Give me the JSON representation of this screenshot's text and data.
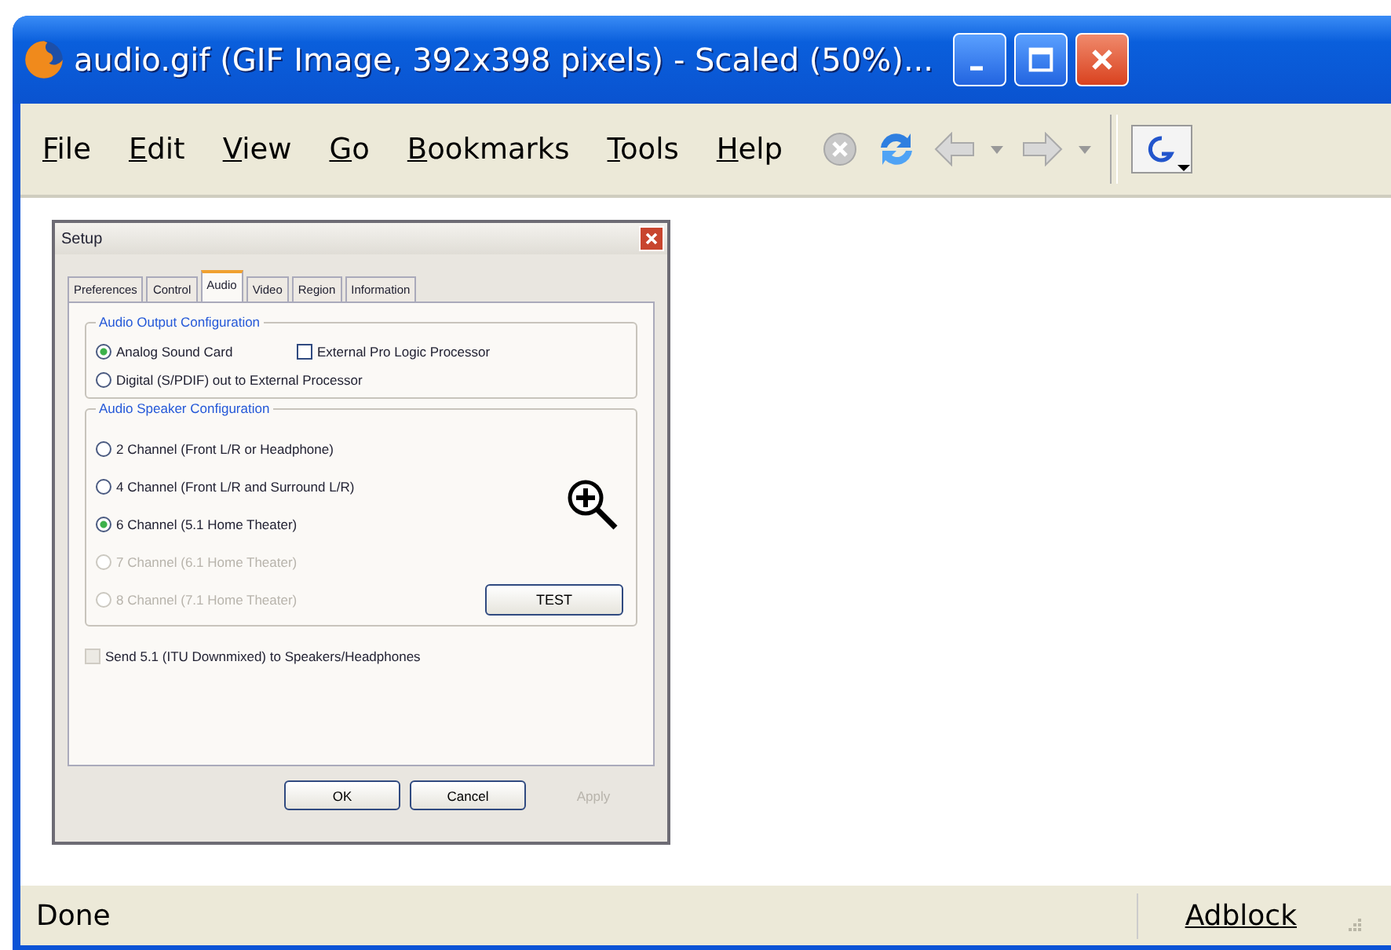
{
  "window": {
    "title": "audio.gif (GIF Image, 392x398 pixels) - Scaled (50%)..."
  },
  "menu": [
    {
      "label": "File"
    },
    {
      "label": "Edit"
    },
    {
      "label": "View"
    },
    {
      "label": "Go"
    },
    {
      "label": "Bookmarks"
    },
    {
      "label": "Tools"
    },
    {
      "label": "Help"
    }
  ],
  "image": {
    "dialog": {
      "title": "Setup",
      "tabs": [
        {
          "label": "Preferences",
          "selected": false
        },
        {
          "label": "Control",
          "selected": false
        },
        {
          "label": "Audio",
          "selected": true
        },
        {
          "label": "Video",
          "selected": false
        },
        {
          "label": "Region",
          "selected": false
        },
        {
          "label": "Information",
          "selected": false
        }
      ],
      "output_group": {
        "title": "Audio Output Configuration",
        "options": [
          {
            "kind": "radio",
            "label": "Analog Sound Card",
            "checked": true
          },
          {
            "kind": "checkbox",
            "label": "External Pro Logic Processor",
            "checked": false
          },
          {
            "kind": "radio",
            "label": "Digital (S/PDIF) out to External Processor",
            "checked": false
          }
        ]
      },
      "speaker_group": {
        "title": "Audio Speaker Configuration",
        "options": [
          {
            "label": "2 Channel (Front L/R or Headphone)",
            "selected": false,
            "disabled": false
          },
          {
            "label": "4 Channel (Front L/R and Surround L/R)",
            "selected": false,
            "disabled": false
          },
          {
            "label": "6 Channel (5.1 Home Theater)",
            "selected": true,
            "disabled": false
          },
          {
            "label": "7 Channel (6.1 Home Theater)",
            "selected": false,
            "disabled": true
          },
          {
            "label": "8 Channel (7.1 Home Theater)",
            "selected": false,
            "disabled": true
          }
        ],
        "test_button": "TEST"
      },
      "downmix": {
        "label": "Send 5.1 (ITU Downmixed) to Speakers/Headphones",
        "checked": false,
        "disabled": true
      },
      "buttons": [
        {
          "label": "OK",
          "disabled": false
        },
        {
          "label": "Cancel",
          "disabled": false
        },
        {
          "label": "Apply",
          "disabled": true
        }
      ]
    }
  },
  "status_bar": {
    "text": "Done",
    "panel": "Adblock"
  }
}
